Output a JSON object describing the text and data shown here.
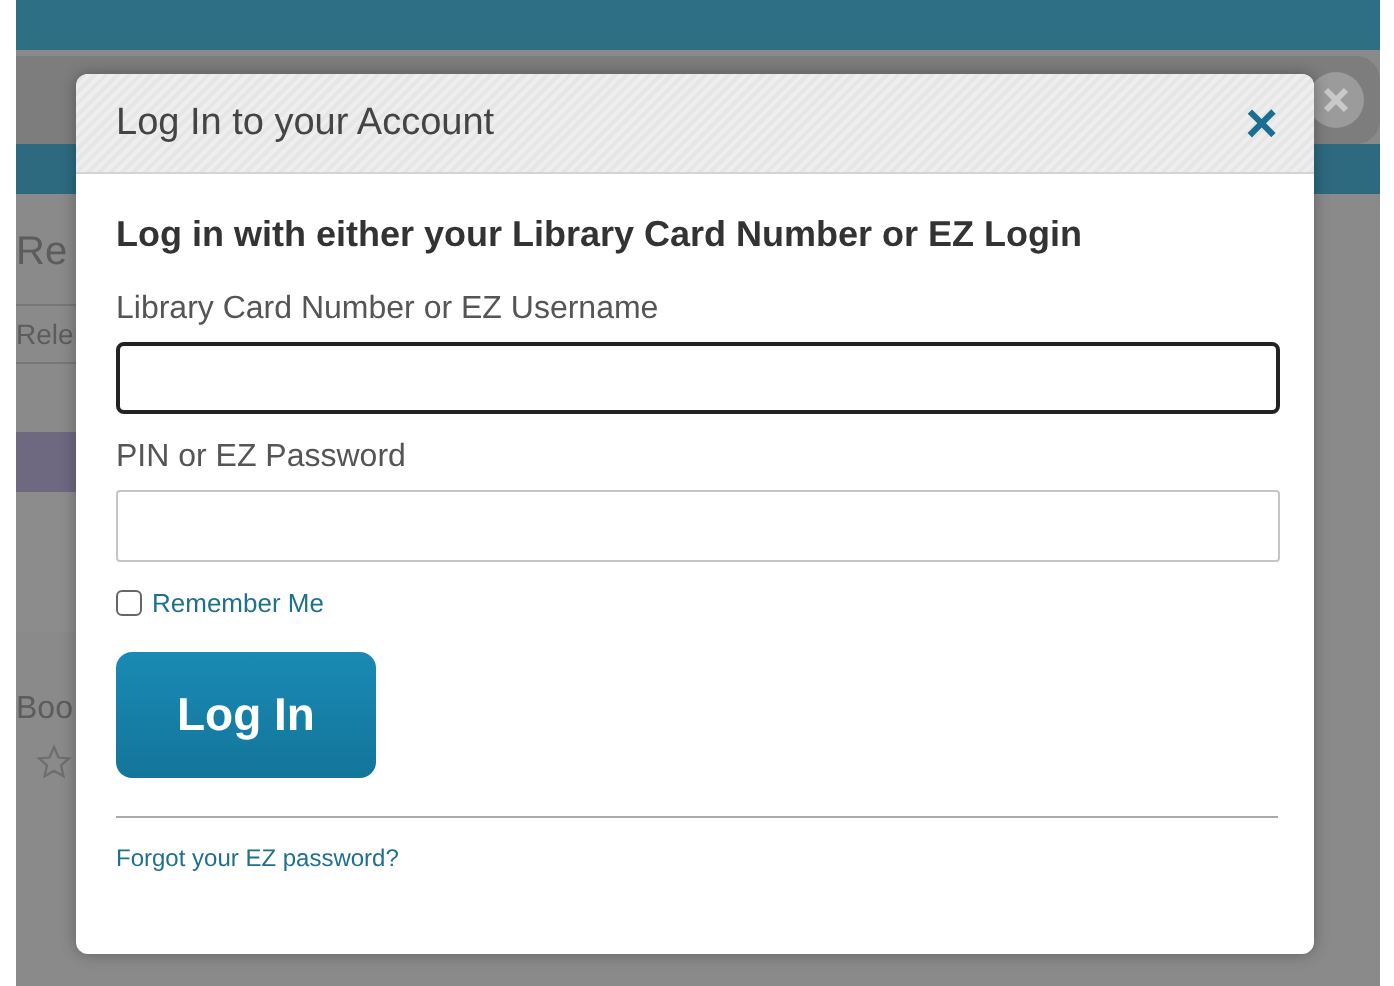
{
  "background": {
    "heading": "Re",
    "sort_label": "Rele",
    "item_title": "Boo"
  },
  "dialog": {
    "title": "Log In to your Account",
    "close": "×",
    "heading": "Log in with either your Library Card Number or EZ Login",
    "fields": [
      {
        "label": "Library Card Number or EZ Username",
        "focused": true
      },
      {
        "label": "PIN or EZ Password",
        "focused": false
      }
    ],
    "remember": {
      "label": "Remember Me",
      "checked": false
    },
    "submit": "Log In",
    "forgot": "Forgot your EZ password?"
  }
}
